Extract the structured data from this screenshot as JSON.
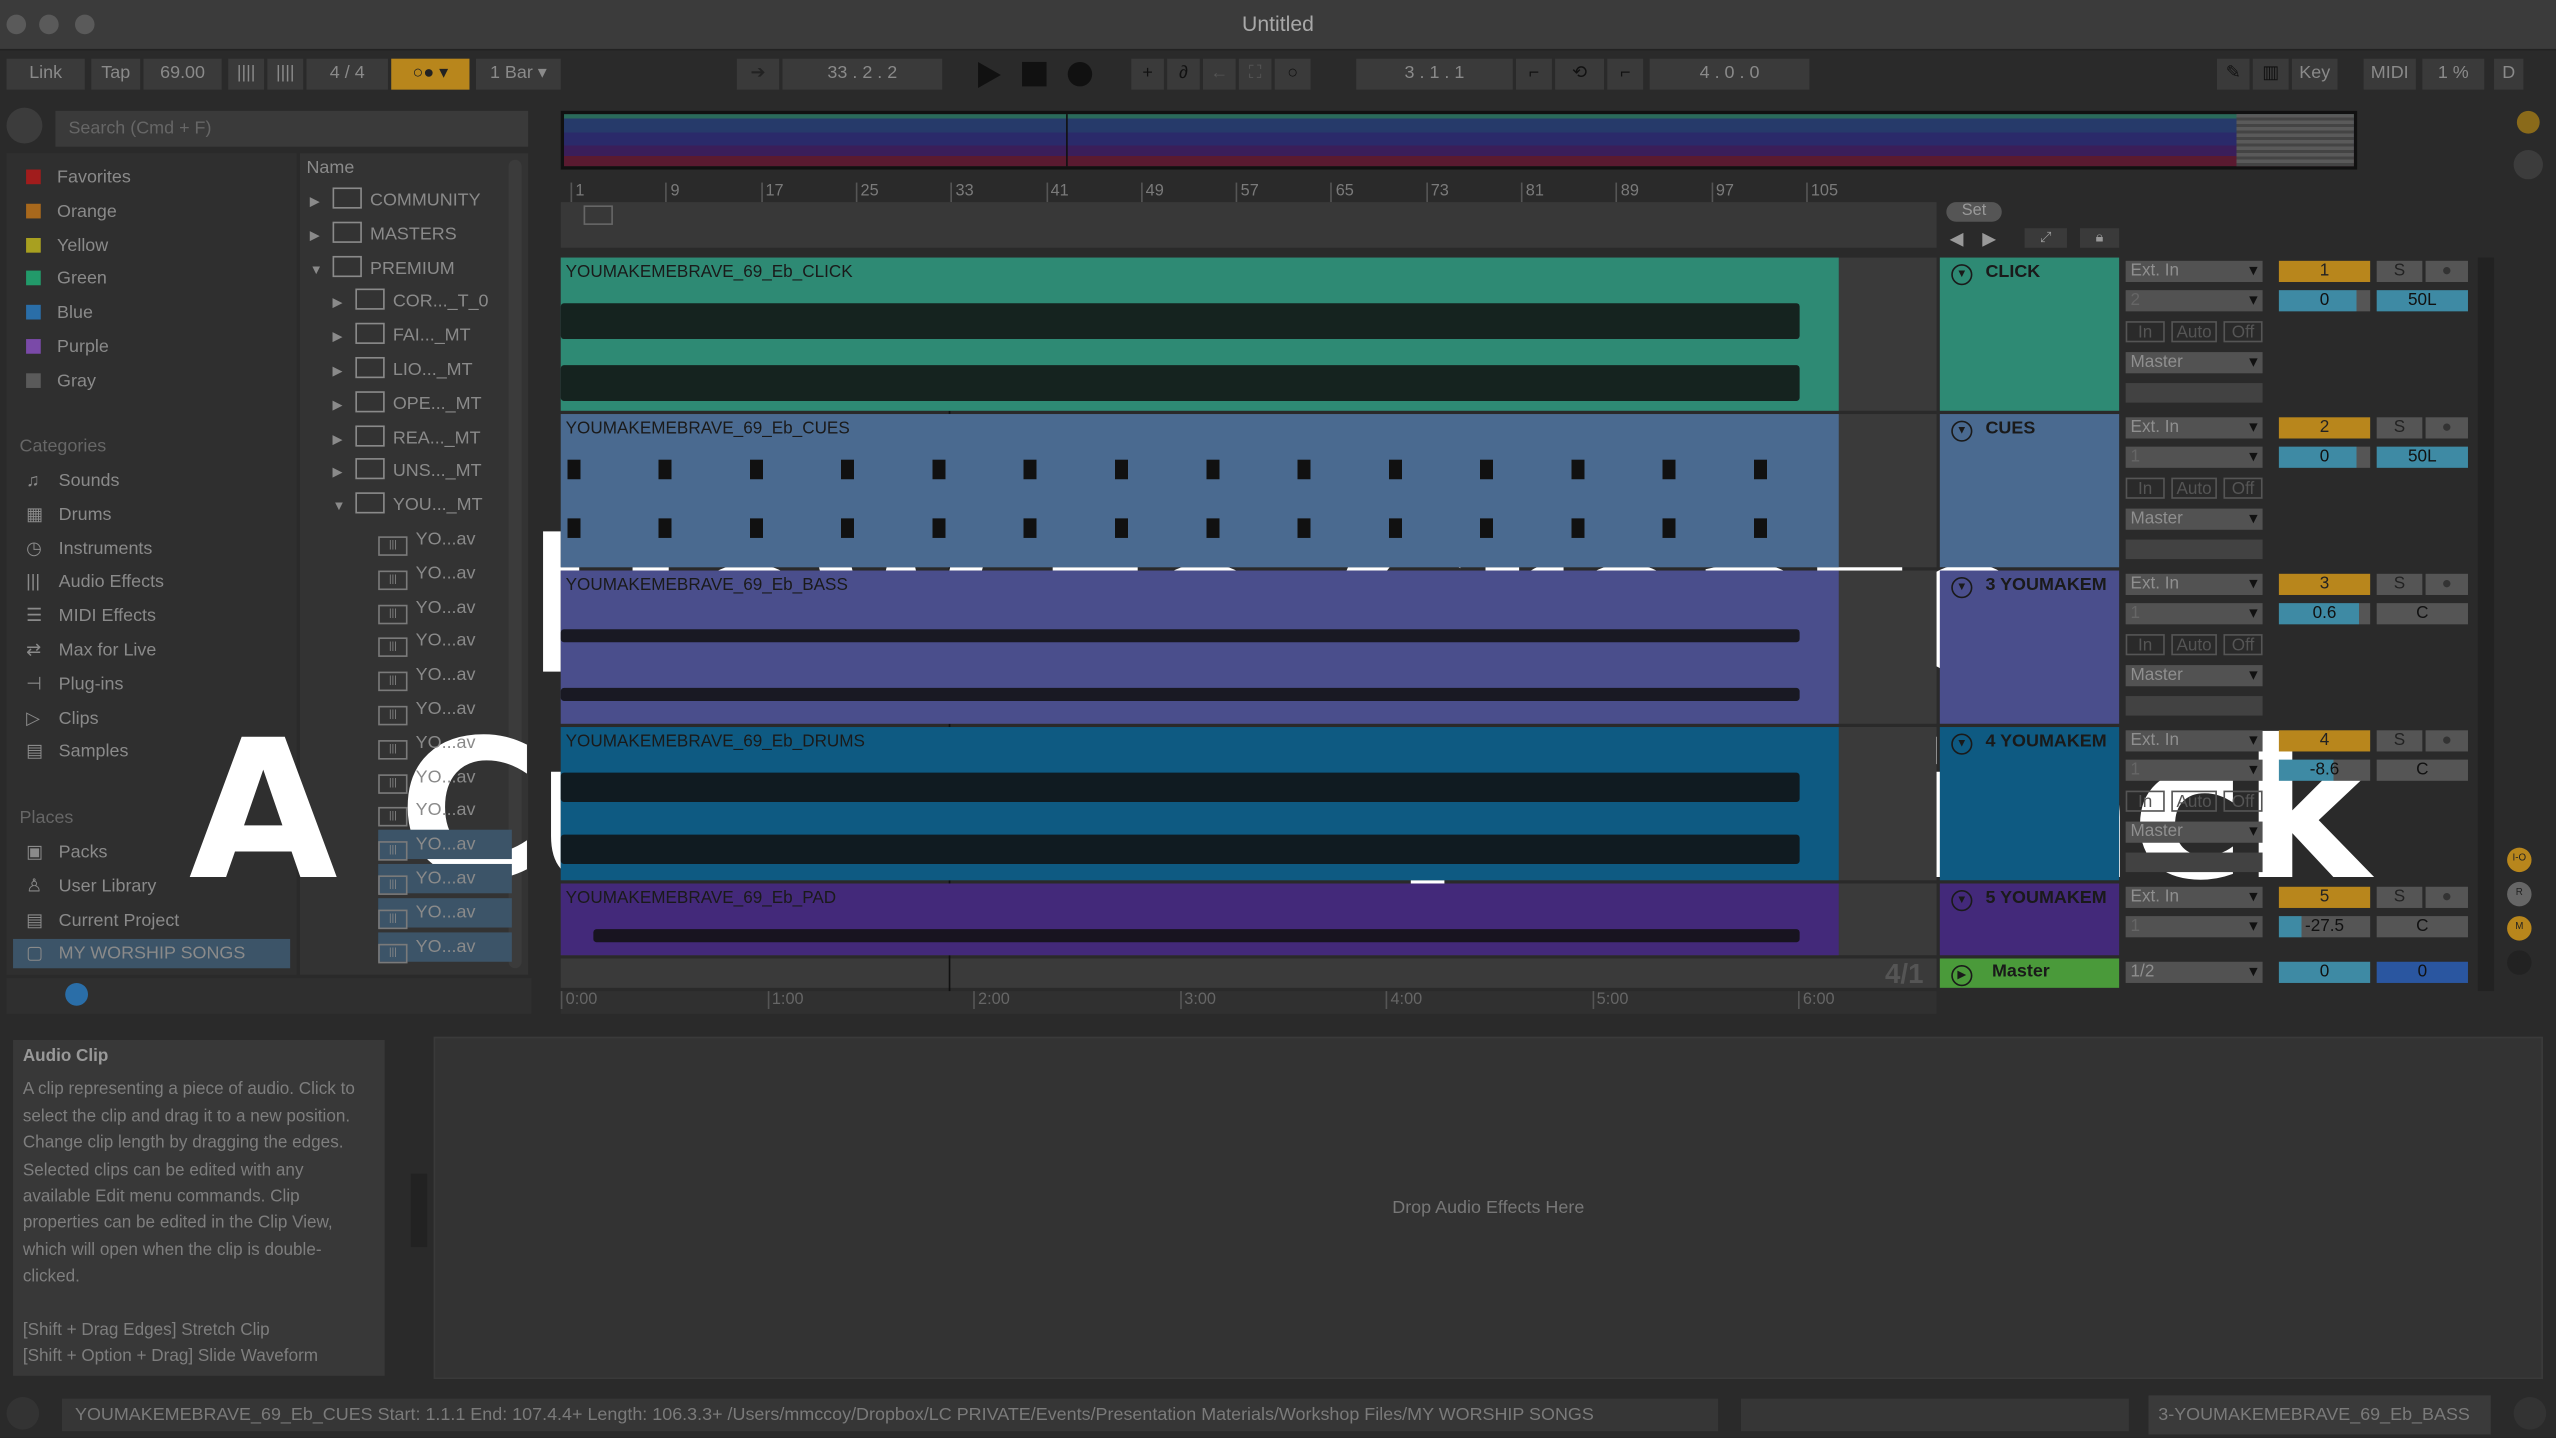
{
  "window": {
    "title": "Untitled"
  },
  "toolbar": {
    "link": "Link",
    "tap": "Tap",
    "tempo": "69.00",
    "sig_num": "4",
    "sig_sep": "/",
    "sig_den": "4",
    "quantize": "1 Bar",
    "position": "33 . 2 . 2",
    "loop_start": "3 . 1 . 1",
    "loop_length": "4 . 0 . 0",
    "key": "Key",
    "midi": "MIDI",
    "cpu": "1 %",
    "disk": "D",
    "accent": "#b8861c"
  },
  "browser": {
    "search_placeholder": "Search (Cmd + F)",
    "colors": [
      {
        "label": "Favorites",
        "color": "#a11c1c"
      },
      {
        "label": "Orange",
        "color": "#a8681c"
      },
      {
        "label": "Yellow",
        "color": "#a8a020"
      },
      {
        "label": "Green",
        "color": "#229a6a"
      },
      {
        "label": "Blue",
        "color": "#2a6ea8"
      },
      {
        "label": "Purple",
        "color": "#7a4aa8"
      },
      {
        "label": "Gray",
        "color": "#5a5a5a"
      }
    ],
    "categories_heading": "Categories",
    "categories": [
      "Sounds",
      "Drums",
      "Instruments",
      "Audio Effects",
      "MIDI Effects",
      "Max for Live",
      "Plug-ins",
      "Clips",
      "Samples"
    ],
    "places_heading": "Places",
    "places": [
      "Packs",
      "User Library",
      "Current Project",
      "MY WORSHIP SONGS"
    ],
    "column_name": "Name",
    "tree": [
      {
        "label": "COMMUNITY",
        "level": 0
      },
      {
        "label": "MASTERS",
        "level": 0
      },
      {
        "label": "PREMIUM",
        "level": 0
      },
      {
        "label": "COR..._T_0",
        "level": 1
      },
      {
        "label": "FAI..._MT",
        "level": 1
      },
      {
        "label": "LIO..._MT",
        "level": 1
      },
      {
        "label": "OPE..._MT",
        "level": 1
      },
      {
        "label": "REA..._MT",
        "level": 1
      },
      {
        "label": "UNS..._MT",
        "level": 1
      },
      {
        "label": "YOU..._MT",
        "level": 1
      }
    ],
    "files": [
      "YO...av",
      "YO...av",
      "YO...av",
      "YO...av",
      "YO...av",
      "YO...av",
      "YO...av",
      "YO...av",
      "YO...av",
      "YO...av",
      "YO...av",
      "YO...av",
      "YO...av"
    ]
  },
  "arrangement": {
    "bar_ruler": [
      "1",
      "9",
      "17",
      "25",
      "33",
      "41",
      "49",
      "57",
      "65",
      "73",
      "81",
      "89",
      "97",
      "105"
    ],
    "time_ruler": [
      "0:00",
      "1:00",
      "2:00",
      "3:00",
      "4:00",
      "5:00",
      "6:00"
    ],
    "set_label": "Set",
    "zoom_ratio": "4/1"
  },
  "tracks": [
    {
      "clip": "YOUMAKEMEBRAVE_69_Eb_CLICK",
      "name": "CLICK",
      "input": "Ext. In",
      "channel": "2",
      "output": "Master",
      "number": "1",
      "volume": "0",
      "pan": "50L",
      "color": "#2e8a74",
      "vol_fill": 0.85
    },
    {
      "clip": "YOUMAKEMEBRAVE_69_Eb_CUES",
      "name": "CUES",
      "input": "Ext. In",
      "channel": "1",
      "output": "Master",
      "number": "2",
      "volume": "0",
      "pan": "50L",
      "color": "#4a6a90",
      "vol_fill": 0.85
    },
    {
      "clip": "YOUMAKEMEBRAVE_69_Eb_BASS",
      "name": "3 YOUMAKEM",
      "input": "Ext. In",
      "channel": "1",
      "output": "Master",
      "number": "3",
      "volume": "0.6",
      "pan": "C",
      "color": "#4a4e8c",
      "vol_fill": 0.88
    },
    {
      "clip": "YOUMAKEMEBRAVE_69_Eb_DRUMS",
      "name": "4 YOUMAKEM",
      "input": "Ext. In",
      "channel": "1",
      "output": "Master",
      "number": "4",
      "volume": "-8.6",
      "pan": "C",
      "color": "#0e5a82",
      "vol_fill": 0.6
    },
    {
      "clip": "YOUMAKEMEBRAVE_69_Eb_PAD",
      "name": "5 YOUMAKEM",
      "input": "Ext. In",
      "channel": "1",
      "output": "Master",
      "number": "5",
      "volume": "-27.5",
      "pan": "C",
      "color": "#43297a",
      "vol_fill": 0.25
    }
  ],
  "monitor": {
    "in": "In",
    "auto": "Auto",
    "off": "Off",
    "solo": "S"
  },
  "master": {
    "name": "Master",
    "output": "1/2",
    "volume": "0",
    "pan": "0",
    "color": "#4a9a3a"
  },
  "side_buttons": [
    "I-O",
    "R",
    "M",
    "D"
  ],
  "info": {
    "title": "Audio Clip",
    "body": "A clip representing a piece of audio. Click to select the clip and drag it to a new position. Change clip length by dragging the edges. Selected clips can be edited with any available Edit menu commands. Clip properties can be edited in the Clip View, which will open when the clip is double-clicked.",
    "shortcut1": "[Shift + Drag Edges] Stretch Clip",
    "shortcut2": "[Shift + Option + Drag] Slide Waveform"
  },
  "device_view": {
    "drop_text": "Drop Audio Effects Here"
  },
  "status": {
    "text": "YOUMAKEMEBRAVE_69_Eb_CUES  Start: 1.1.1  End: 107.4.4+  Length: 106.3.3+  /Users/mmccoy/Dropbox/LC PRIVATE/Events/Presentation Materials/Workshop Files/MY WORSHIP SONGS",
    "selected_track": "3-YOUMAKEMEBRAVE_69_Eb_BASS"
  },
  "overlay": {
    "line1": "How to Create",
    "line2": "A Custom Split Track"
  }
}
